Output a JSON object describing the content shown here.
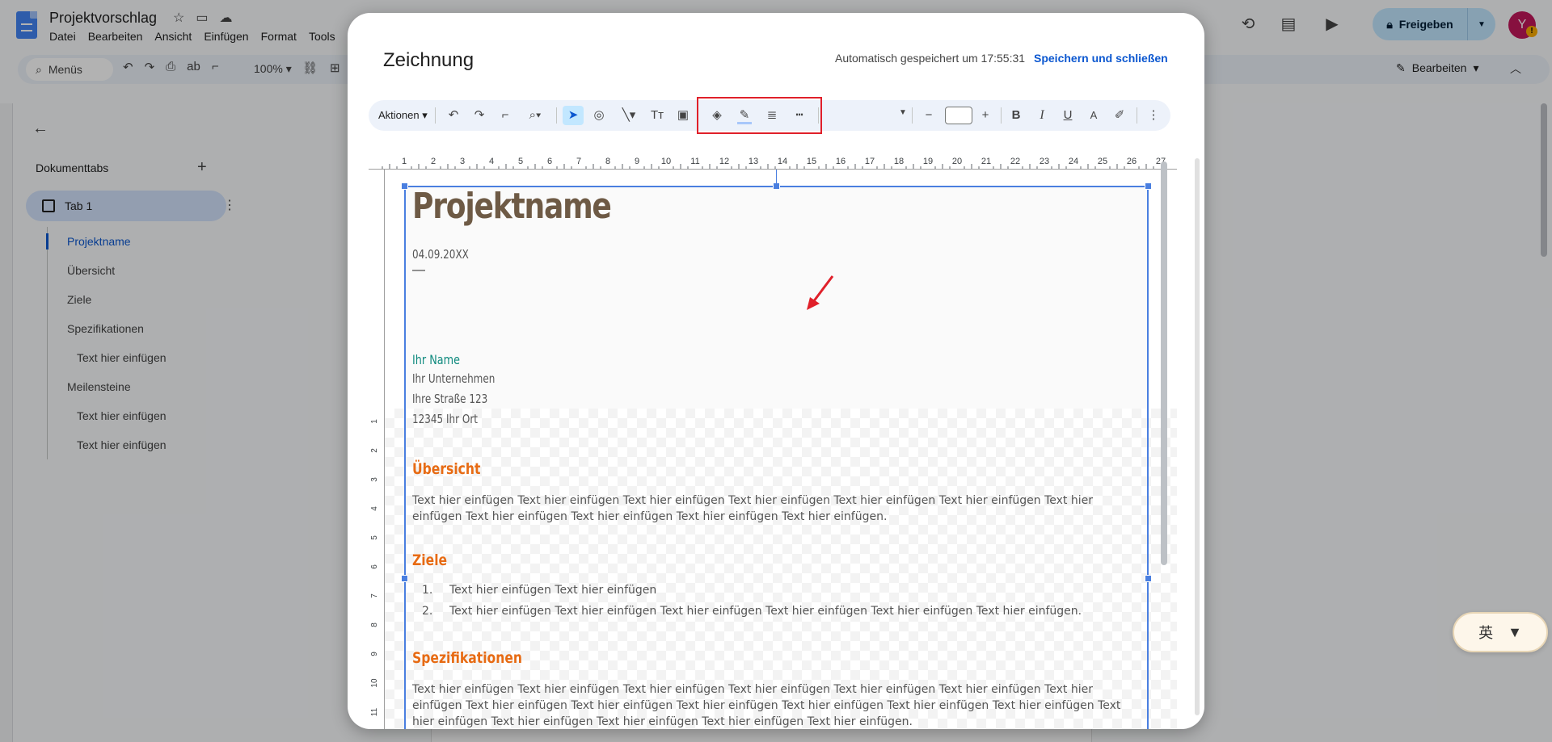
{
  "docs": {
    "title": "Projektvorschlag",
    "menu": [
      "Datei",
      "Bearbeiten",
      "Ansicht",
      "Einfügen",
      "Format",
      "Tools"
    ],
    "toolbar": {
      "menus_label": "Menüs",
      "zoom": "100%",
      "mode_label": "Bearbeiten"
    },
    "share_label": "Freigeben",
    "avatar_letter": "Y",
    "avatar_badge": "!"
  },
  "outline": {
    "heading": "Dokumenttabs",
    "tab_label": "Tab 1",
    "items": [
      {
        "label": "Projektname",
        "level": 1,
        "active": true
      },
      {
        "label": "Übersicht",
        "level": 1
      },
      {
        "label": "Ziele",
        "level": 1
      },
      {
        "label": "Spezifikationen",
        "level": 1
      },
      {
        "label": "Text hier einfügen",
        "level": 2
      },
      {
        "label": "Meilensteine",
        "level": 1
      },
      {
        "label": "Text hier einfügen",
        "level": 2
      },
      {
        "label": "Text hier einfügen",
        "level": 2
      }
    ]
  },
  "ime": {
    "char": "英"
  },
  "modal": {
    "title": "Zeichnung",
    "autosave_text": "Automatisch gespeichert um 17:55:31",
    "save_close_label": "Speichern und schließen",
    "actions_label": "Aktionen",
    "ruler_numbers": [
      "1",
      "2",
      "3",
      "4",
      "5",
      "6",
      "7",
      "8",
      "9",
      "10",
      "11",
      "12",
      "13",
      "14",
      "15",
      "16",
      "17",
      "18",
      "19",
      "20",
      "21",
      "22",
      "23",
      "24",
      "25",
      "26",
      "27"
    ],
    "v_ruler_numbers": [
      "1",
      "2",
      "3",
      "4",
      "5",
      "6",
      "7",
      "8",
      "9",
      "10",
      "11"
    ]
  },
  "content": {
    "title": "Projektname",
    "date": "04.09.20XX",
    "dash": "—",
    "name": "Ihr Name",
    "company": "Ihr Unternehmen",
    "street": "Ihre Straße 123",
    "city": "12345 Ihr Ort",
    "h_overview": "Übersicht",
    "p_overview": "Text hier einfügen Text hier einfügen Text hier einfügen Text hier einfügen Text hier einfügen Text hier einfügen Text hier einfügen Text hier einfügen Text hier einfügen Text hier einfügen Text hier einfügen.",
    "h_goals": "Ziele",
    "goals": [
      {
        "num": "1.",
        "text": "Text hier einfügen Text hier einfügen"
      },
      {
        "num": "2.",
        "text": "Text hier einfügen Text hier einfügen Text hier einfügen Text hier einfügen Text hier einfügen Text hier einfügen."
      }
    ],
    "h_specs": "Spezifikationen",
    "p_specs": "Text hier einfügen Text hier einfügen Text hier einfügen Text hier einfügen Text hier einfügen Text hier einfügen Text hier einfügen Text hier einfügen Text hier einfügen Text hier einfügen Text hier einfügen Text hier einfügen Text hier einfügen Text hier einfügen Text hier einfügen Text hier einfügen Text hier einfügen Text hier einfügen."
  },
  "colors": {
    "accent_blue": "#0b57d0",
    "heading_orange": "#e76b14",
    "title_brown": "#6e5a45",
    "name_teal": "#0f8a7e",
    "highlight_red": "#e0202a"
  }
}
